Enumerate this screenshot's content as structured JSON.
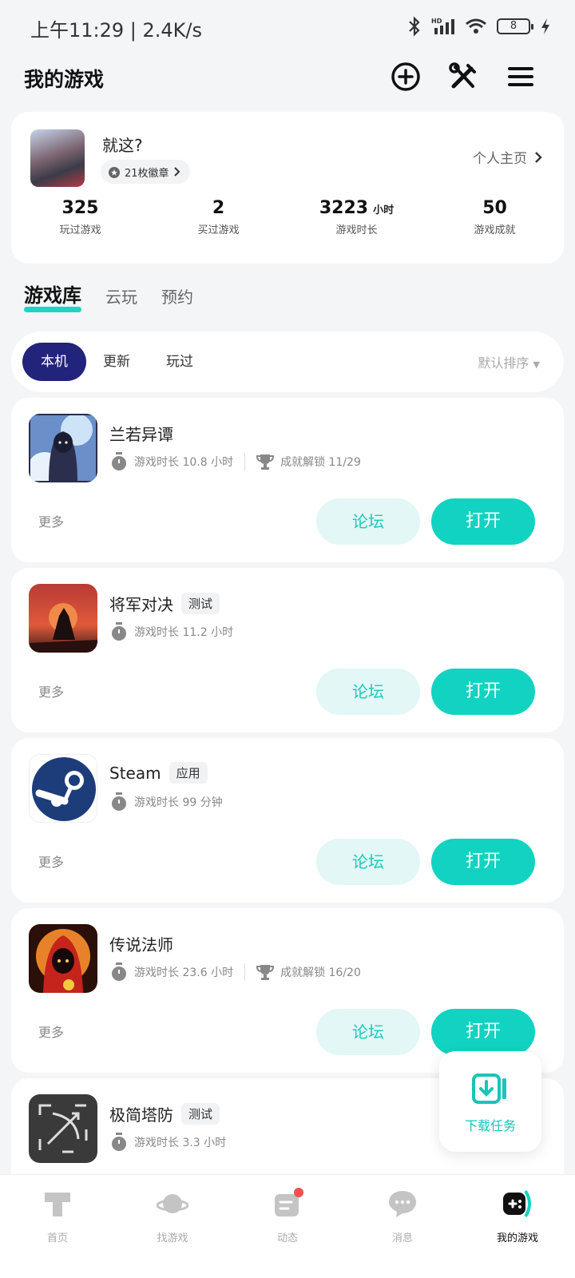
{
  "status": {
    "time": "上午11:29 | 2.4K/s",
    "battery": "8"
  },
  "header": {
    "title": "我的游戏"
  },
  "profile": {
    "name": "就这?",
    "badge": "21枚徽章",
    "homepage": "个人主页",
    "stats": [
      {
        "value": "325",
        "unit": "",
        "label": "玩过游戏"
      },
      {
        "value": "2",
        "unit": "",
        "label": "买过游戏"
      },
      {
        "value": "3223",
        "unit": "小时",
        "label": "游戏时长"
      },
      {
        "value": "50",
        "unit": "",
        "label": "游戏成就"
      }
    ]
  },
  "tabs": [
    "游戏库",
    "云玩",
    "预约"
  ],
  "filters": {
    "chips": [
      "本机",
      "更新",
      "玩过"
    ],
    "sort": "默认排序"
  },
  "games": [
    {
      "name": "兰若异谭",
      "tag": "",
      "playtime": "游戏时长 10.8 小时",
      "achievement": "成就解锁 11/29"
    },
    {
      "name": "将军对决",
      "tag": "测试",
      "playtime": "游戏时长 11.2 小时",
      "achievement": ""
    },
    {
      "name": "Steam",
      "tag": "应用",
      "playtime": "游戏时长 99 分钟",
      "achievement": ""
    },
    {
      "name": "传说法师",
      "tag": "",
      "playtime": "游戏时长 23.6 小时",
      "achievement": "成就解锁 16/20"
    },
    {
      "name": "极简塔防",
      "tag": "测试",
      "playtime": "游戏时长 3.3 小时",
      "achievement": ""
    }
  ],
  "card_actions": {
    "more": "更多",
    "forum": "论坛",
    "open": "打开"
  },
  "float": {
    "label": "下载任务"
  },
  "nav": [
    "首页",
    "找游戏",
    "动态",
    "消息",
    "我的游戏"
  ],
  "colors": {
    "accent": "#12d3c1",
    "chip_active": "#22237a",
    "notification": "#f25050"
  }
}
